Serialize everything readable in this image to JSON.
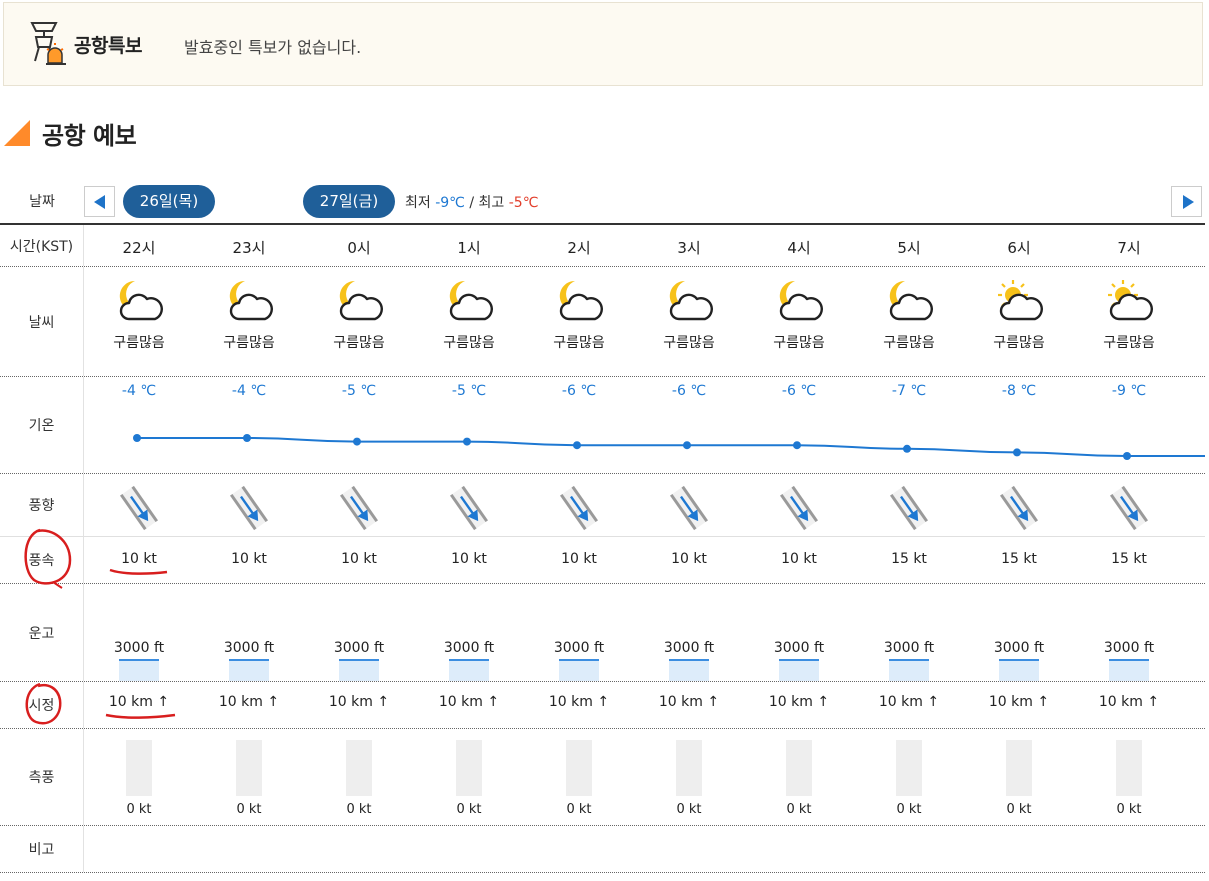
{
  "warning": {
    "title": "공항특보",
    "message": "발효중인 특보가 없습니다."
  },
  "section_title": "공항 예보",
  "date_row": {
    "label": "날짜",
    "prev_icon": "left-arrow-icon",
    "next_icon": "right-arrow-icon",
    "day1": "26일(목)",
    "day2": "27일(금)",
    "min_label": "최저",
    "min_value": "-9℃",
    "sep": " / ",
    "max_label": "최고",
    "max_value": "-5℃"
  },
  "row_labels": {
    "time": "시간(KST)",
    "weather": "날씨",
    "temperature": "기온",
    "wind_dir": "풍향",
    "wind_speed": "풍속",
    "ceiling": "운고",
    "visibility": "시정",
    "crosswind": "측풍",
    "remarks": "비고"
  },
  "hours": [
    {
      "time": "22시",
      "weather": "구름많음",
      "icon": "cloud-moon-icon",
      "temp": "-4 ℃",
      "temp_value": -4,
      "speed": "10 kt",
      "ceiling": "3000 ft",
      "vis": "10 km ↑",
      "xw": "0 kt"
    },
    {
      "time": "23시",
      "weather": "구름많음",
      "icon": "cloud-moon-icon",
      "temp": "-4 ℃",
      "temp_value": -4,
      "speed": "10 kt",
      "ceiling": "3000 ft",
      "vis": "10 km ↑",
      "xw": "0 kt"
    },
    {
      "time": "0시",
      "weather": "구름많음",
      "icon": "cloud-moon-icon",
      "temp": "-5 ℃",
      "temp_value": -5,
      "speed": "10 kt",
      "ceiling": "3000 ft",
      "vis": "10 km ↑",
      "xw": "0 kt"
    },
    {
      "time": "1시",
      "weather": "구름많음",
      "icon": "cloud-moon-icon",
      "temp": "-5 ℃",
      "temp_value": -5,
      "speed": "10 kt",
      "ceiling": "3000 ft",
      "vis": "10 km ↑",
      "xw": "0 kt"
    },
    {
      "time": "2시",
      "weather": "구름많음",
      "icon": "cloud-moon-icon",
      "temp": "-6 ℃",
      "temp_value": -6,
      "speed": "10 kt",
      "ceiling": "3000 ft",
      "vis": "10 km ↑",
      "xw": "0 kt"
    },
    {
      "time": "3시",
      "weather": "구름많음",
      "icon": "cloud-moon-icon",
      "temp": "-6 ℃",
      "temp_value": -6,
      "speed": "10 kt",
      "ceiling": "3000 ft",
      "vis": "10 km ↑",
      "xw": "0 kt"
    },
    {
      "time": "4시",
      "weather": "구름많음",
      "icon": "cloud-moon-icon",
      "temp": "-6 ℃",
      "temp_value": -6,
      "speed": "10 kt",
      "ceiling": "3000 ft",
      "vis": "10 km ↑",
      "xw": "0 kt"
    },
    {
      "time": "5시",
      "weather": "구름많음",
      "icon": "cloud-moon-icon",
      "temp": "-7 ℃",
      "temp_value": -7,
      "speed": "15 kt",
      "ceiling": "3000 ft",
      "vis": "10 km ↑",
      "xw": "0 kt"
    },
    {
      "time": "6시",
      "weather": "구름많음",
      "icon": "cloud-sun-icon",
      "temp": "-8 ℃",
      "temp_value": -8,
      "speed": "15 kt",
      "ceiling": "3000 ft",
      "vis": "10 km ↑",
      "xw": "0 kt"
    },
    {
      "time": "7시",
      "weather": "구름많음",
      "icon": "cloud-sun-icon",
      "temp": "-9 ℃",
      "temp_value": -9,
      "speed": "15 kt",
      "ceiling": "3000 ft",
      "vis": "10 km ↑",
      "xw": "0 kt"
    }
  ],
  "colors": {
    "date_pill": "#1f5f99",
    "temp_line": "#1e78d2",
    "max_temp": "#e23d2a",
    "accent_triangle": "#ff8a2a",
    "annotation": "#d81e1e"
  }
}
